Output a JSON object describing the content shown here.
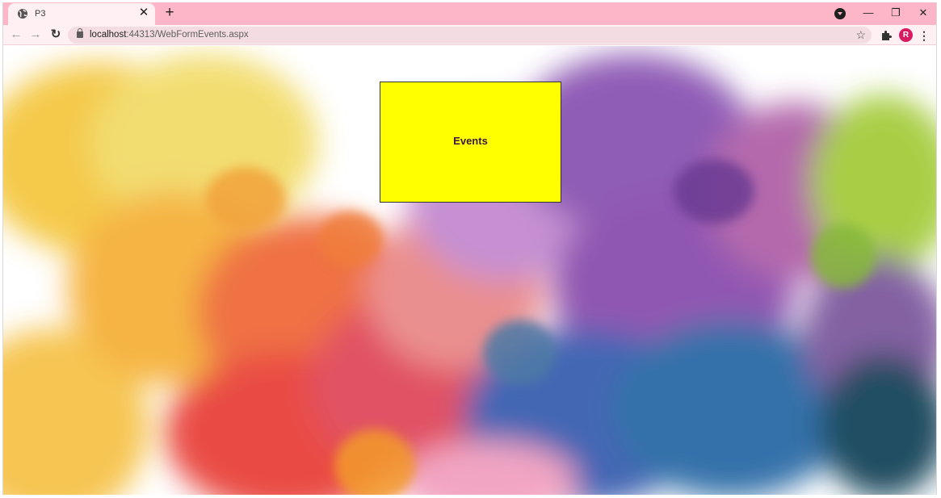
{
  "browser": {
    "tab": {
      "title": "P3",
      "favicon": "globe-icon",
      "close_icon": "close-icon"
    },
    "new_tab_icon": "plus-icon",
    "tab_search_icon": "chevron-down-icon",
    "window_controls": {
      "minimize": "minimize-icon",
      "maximize": "restore-icon",
      "close": "close-icon"
    },
    "nav": {
      "back": "back-arrow-icon",
      "forward": "forward-arrow-icon",
      "reload": "reload-icon"
    },
    "address": {
      "host": "localhost",
      "path": ":44313/WebFormEvents.aspx",
      "lock_icon": "lock-icon",
      "bookmark_icon": "star-icon"
    },
    "extensions_icon": "puzzle-icon",
    "profile_initial": "R",
    "menu_icon": "kebab-menu-icon",
    "theme": {
      "tabstrip": "#fcb6c7",
      "toolbar": "#fff0f4",
      "profile": "#d81b60"
    }
  },
  "page": {
    "background": "paint-splash-watercolor",
    "button": {
      "label": "Events",
      "color": "#ffff00"
    }
  }
}
